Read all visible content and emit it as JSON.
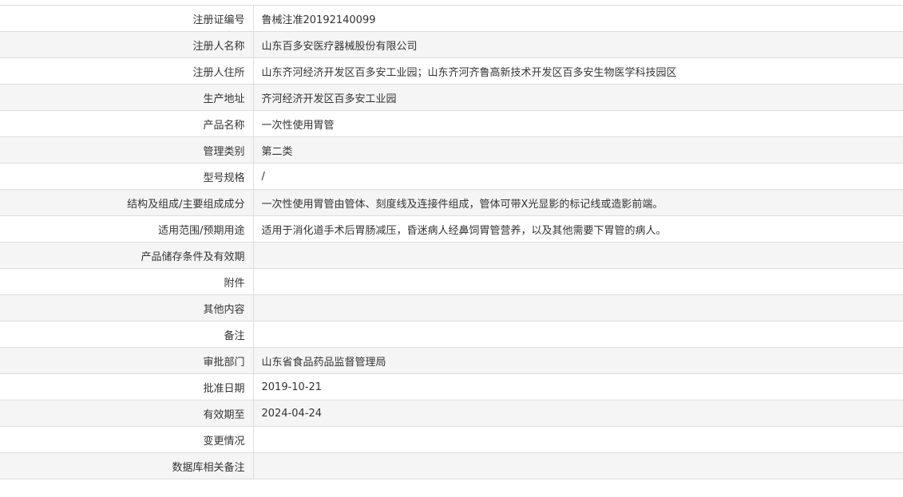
{
  "rows": [
    {
      "label": "注册证编号",
      "value": "鲁械注准20192140099"
    },
    {
      "label": "注册人名称",
      "value": "山东百多安医疗器械股份有限公司"
    },
    {
      "label": "注册人住所",
      "value": "山东齐河经济开发区百多安工业园；山东齐河齐鲁高新技术开发区百多安生物医学科技园区"
    },
    {
      "label": "生产地址",
      "value": "齐河经济开发区百多安工业园"
    },
    {
      "label": "产品名称",
      "value": "一次性使用胃管"
    },
    {
      "label": "管理类别",
      "value": "第二类"
    },
    {
      "label": "型号规格",
      "value": "/"
    },
    {
      "label": "结构及组成/主要组成成分",
      "value": "一次性使用胃管由管体、刻度线及连接件组成，管体可带X光显影的标记线或造影前端。"
    },
    {
      "label": "适用范围/预期用途",
      "value": "适用于消化道手术后胃肠减压，昏迷病人经鼻饲胃管营养，以及其他需要下胃管的病人。"
    },
    {
      "label": "产品储存条件及有效期",
      "value": ""
    },
    {
      "label": "附件",
      "value": ""
    },
    {
      "label": "其他内容",
      "value": ""
    },
    {
      "label": "备注",
      "value": ""
    },
    {
      "label": "审批部门",
      "value": "山东省食品药品监督管理局"
    },
    {
      "label": "批准日期",
      "value": "2019-10-21"
    },
    {
      "label": "有效期至",
      "value": "2024-04-24"
    },
    {
      "label": "变更情况",
      "value": ""
    },
    {
      "label": "数据库相关备注",
      "value": ""
    }
  ]
}
